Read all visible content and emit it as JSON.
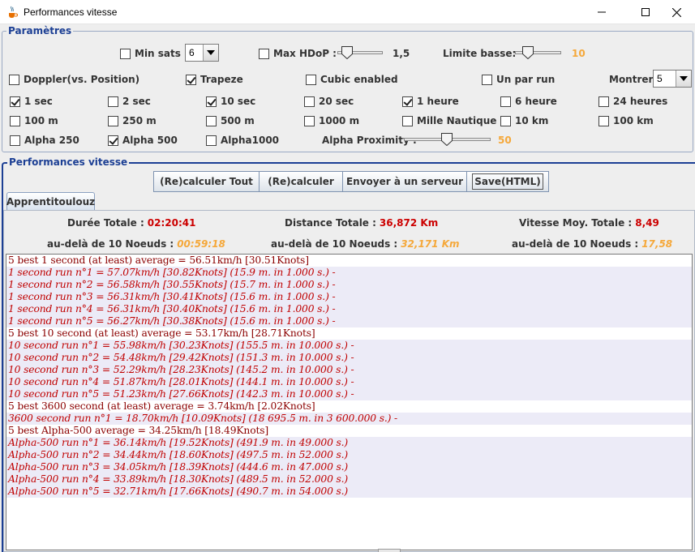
{
  "window": {
    "title": "Performances vitesse"
  },
  "params": {
    "group_title": "Paramètres",
    "min_sats": {
      "label": "Min sats :",
      "checked": false,
      "value": "6"
    },
    "max_hdop": {
      "label": "Max HDoP :",
      "checked": false,
      "value": "1,5"
    },
    "limite_basse": {
      "label": "Limite basse:",
      "value": "10"
    },
    "doppler": {
      "label": "Doppler(vs. Position)",
      "checked": false
    },
    "trapeze": {
      "label": "Trapeze",
      "checked": true
    },
    "cubic": {
      "label": "Cubic enabled",
      "checked": false
    },
    "un_par_run": {
      "label": "Un par run",
      "checked": false
    },
    "montrer": {
      "label": "Montrer :",
      "value": "5"
    },
    "durations": [
      {
        "label": "1 sec",
        "checked": true
      },
      {
        "label": "2 sec",
        "checked": false
      },
      {
        "label": "10 sec",
        "checked": true
      },
      {
        "label": "20 sec",
        "checked": false
      },
      {
        "label": "1 heure",
        "checked": true
      },
      {
        "label": "6 heure",
        "checked": false
      },
      {
        "label": "24 heures",
        "checked": false
      }
    ],
    "distances": [
      {
        "label": "100 m",
        "checked": false
      },
      {
        "label": "250 m",
        "checked": false
      },
      {
        "label": "500 m",
        "checked": false
      },
      {
        "label": "1000 m",
        "checked": false
      },
      {
        "label": "Mille Nautique",
        "checked": false
      },
      {
        "label": "10 km",
        "checked": false
      },
      {
        "label": "100 km",
        "checked": false
      }
    ],
    "alphas": [
      {
        "label": "Alpha 250",
        "checked": false
      },
      {
        "label": "Alpha 500",
        "checked": true
      },
      {
        "label": "Alpha1000",
        "checked": false
      }
    ],
    "alpha_proximity": {
      "label": "Alpha Proximity :",
      "value": "50"
    }
  },
  "perf": {
    "group_title": "Performances vitesse",
    "buttons": {
      "recalc_all": "(Re)calculer Tout",
      "recalc": "(Re)calculer",
      "send": "Envoyer à un serveur",
      "save": "Save(HTML)"
    },
    "tab": "Apprentitoulouz",
    "stats": {
      "duree_label": "Durée Totale :",
      "duree_value": "02:20:41",
      "distance_label": "Distance Totale :",
      "distance_value": "36,872 Km",
      "vitesse_label": "Vitesse Moy. Totale :",
      "vitesse_value": "8,49",
      "beyond1_label": "au-delà de 10 Noeuds :",
      "beyond1_value": "00:59:18",
      "beyond2_label": "au-delà de 10 Noeuds :",
      "beyond2_value": "32,171 Km",
      "beyond3_label": "au-delà de 10 Noeuds :",
      "beyond3_value": "17,58"
    },
    "log": [
      {
        "type": "head",
        "text": "5 best 1 second (at least) average = 56.51km/h [30.51Knots]"
      },
      {
        "type": "run",
        "text": "1 second run n°1 = 57.07km/h [30.82Knots] (15.9 m. in 1.000 s.) -"
      },
      {
        "type": "run",
        "text": "1 second run n°2 = 56.58km/h [30.55Knots] (15.7 m. in 1.000 s.) -"
      },
      {
        "type": "run",
        "text": "1 second run n°3 = 56.31km/h [30.41Knots] (15.6 m. in 1.000 s.) -"
      },
      {
        "type": "run",
        "text": "1 second run n°4 = 56.31km/h [30.40Knots] (15.6 m. in 1.000 s.) -"
      },
      {
        "type": "run",
        "text": "1 second run n°5 = 56.27km/h [30.38Knots] (15.6 m. in 1.000 s.) -"
      },
      {
        "type": "head",
        "text": "5 best 10 second (at least) average = 53.17km/h [28.71Knots]"
      },
      {
        "type": "run",
        "text": "10 second run n°1 = 55.98km/h [30.23Knots] (155.5 m. in 10.000 s.) -"
      },
      {
        "type": "run",
        "text": "10 second run n°2 = 54.48km/h [29.42Knots] (151.3 m. in 10.000 s.) -"
      },
      {
        "type": "run",
        "text": "10 second run n°3 = 52.29km/h [28.23Knots] (145.2 m. in 10.000 s.) -"
      },
      {
        "type": "run",
        "text": "10 second run n°4 = 51.87km/h [28.01Knots] (144.1 m. in 10.000 s.) -"
      },
      {
        "type": "run",
        "text": "10 second run n°5 = 51.23km/h [27.66Knots] (142.3 m. in 10.000 s.) -"
      },
      {
        "type": "head",
        "text": "5 best 3600 second (at least) average = 3.74km/h [2.02Knots]"
      },
      {
        "type": "run",
        "text": "3600 second run n°1 = 18.70km/h [10.09Knots] (18 695.5 m. in 3 600.000 s.) -"
      },
      {
        "type": "head",
        "text": "5 best Alpha-500 average = 34.25km/h [18.49Knots]"
      },
      {
        "type": "run",
        "text": "Alpha-500 run n°1 = 36.14km/h [19.52Knots] (491.9 m. in 49.000 s.)"
      },
      {
        "type": "run",
        "text": "Alpha-500 run n°2 = 34.44km/h [18.60Knots] (497.5 m. in 52.000 s.)"
      },
      {
        "type": "run",
        "text": "Alpha-500 run n°3 = 34.05km/h [18.39Knots] (444.6 m. in 47.000 s.)"
      },
      {
        "type": "run",
        "text": "Alpha-500 run n°4 = 33.89km/h [18.30Knots] (489.5 m. in 52.000 s.)"
      },
      {
        "type": "run",
        "text": "Alpha-500 run n°5 = 32.71km/h [17.66Knots] (490.7 m. in 54.000 s.)"
      }
    ]
  }
}
